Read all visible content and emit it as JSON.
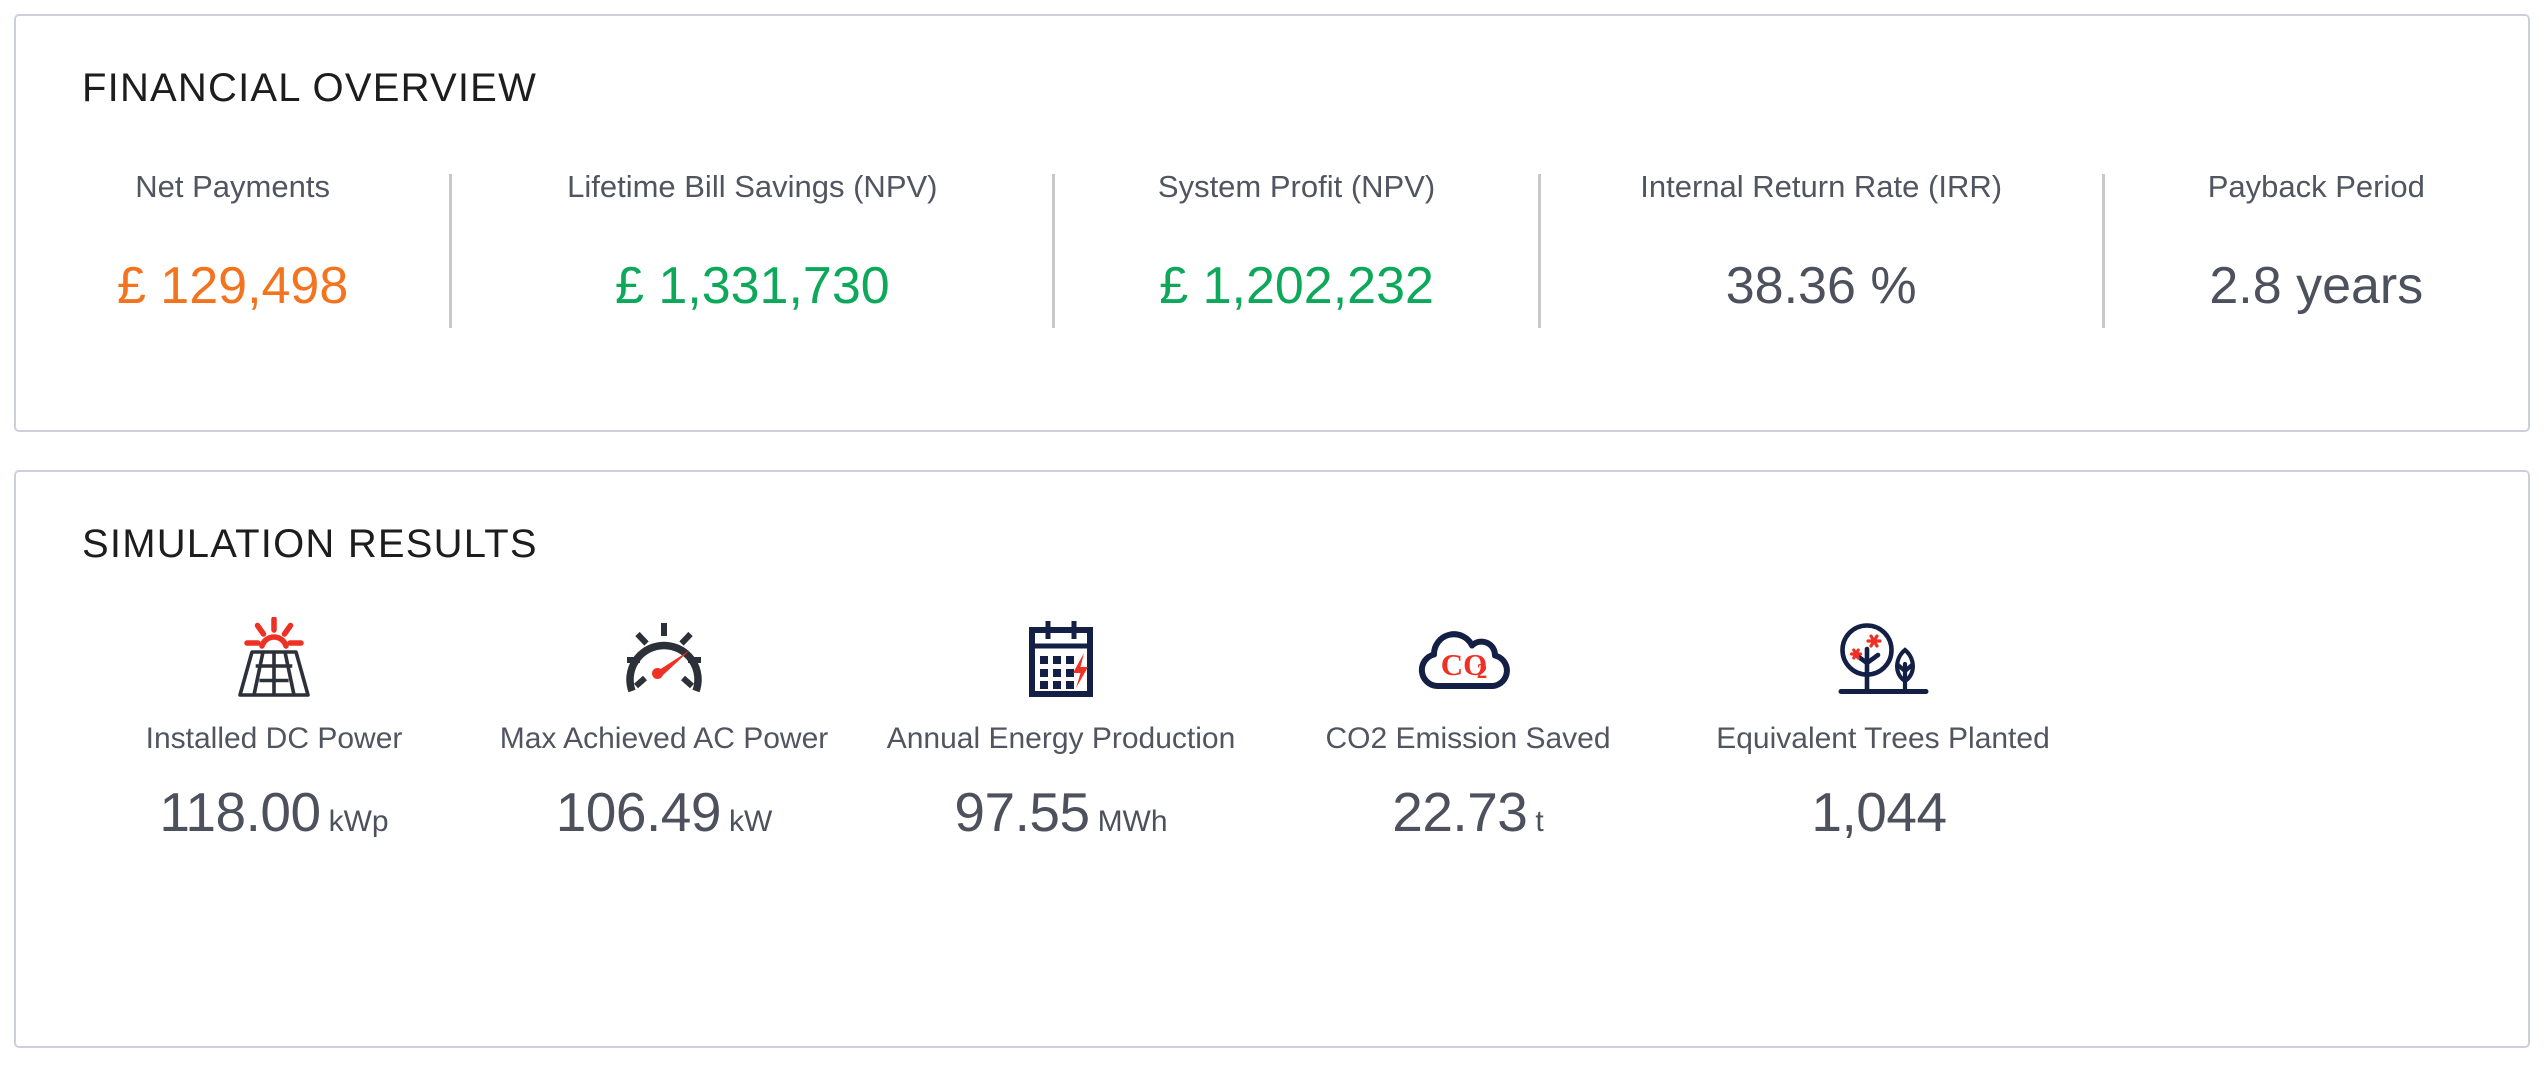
{
  "financial": {
    "title": "FINANCIAL OVERVIEW",
    "colors": {
      "orange": "#f4731e",
      "green": "#0da85a",
      "slate": "#4d515e",
      "label": "#50555f",
      "divider": "#c8c8c8",
      "card_border": "#ccd1d9"
    },
    "metrics": [
      {
        "label": "Net Payments",
        "value": "£ 129,498",
        "tone": "orange"
      },
      {
        "label": "Lifetime Bill Savings (NPV)",
        "value": "£ 1,331,730",
        "tone": "green"
      },
      {
        "label": "System Profit (NPV)",
        "value": "£ 1,202,232",
        "tone": "green"
      },
      {
        "label": "Internal Return Rate (IRR)",
        "value": "38.36 %",
        "tone": "slate"
      },
      {
        "label": "Payback Period",
        "value": "2.8 years",
        "tone": "slate"
      }
    ]
  },
  "simulation": {
    "title": "SIMULATION RESULTS",
    "colors": {
      "icon_navy": "#131f44",
      "icon_dark": "#2c3038",
      "icon_red": "#ee3124",
      "value": "#4d515e",
      "label": "#50555f"
    },
    "metrics": [
      {
        "icon": "solar-panel-icon",
        "label": "Installed DC Power",
        "value": "118.00",
        "unit": "kWp"
      },
      {
        "icon": "gauge-icon",
        "label": "Max Achieved AC Power",
        "value": "106.49",
        "unit": "kW"
      },
      {
        "icon": "calendar-bolt-icon",
        "label": "Annual Energy Production",
        "value": "97.55",
        "unit": "MWh"
      },
      {
        "icon": "co2-cloud-icon",
        "label": "CO2 Emission Saved",
        "value": "22.73",
        "unit": "t"
      },
      {
        "icon": "trees-icon",
        "label": "Equivalent Trees Planted",
        "value": "1,044",
        "unit": ""
      }
    ]
  }
}
